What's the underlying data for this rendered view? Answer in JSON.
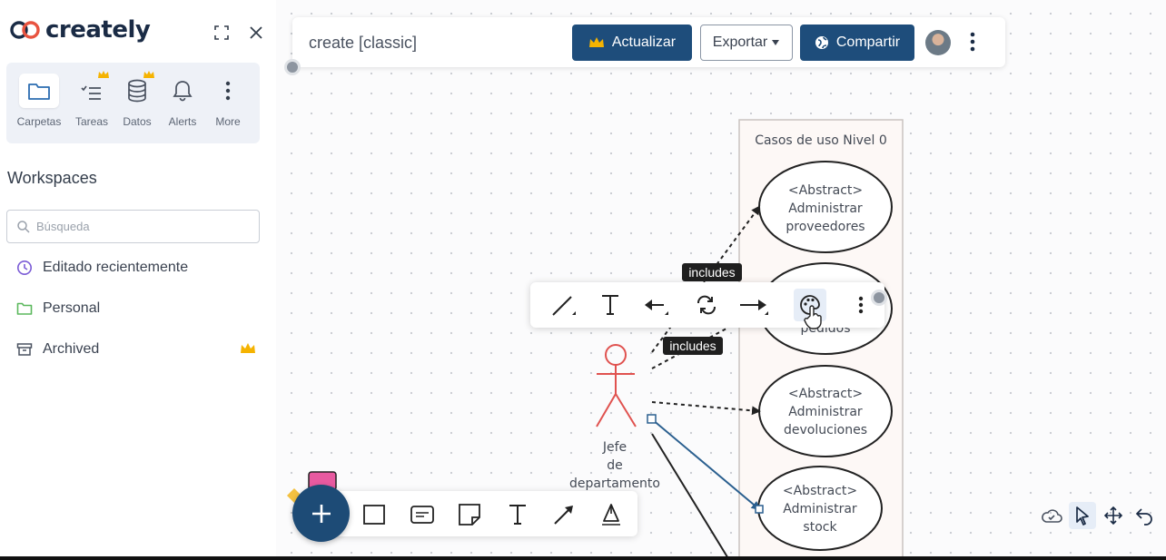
{
  "sidebar": {
    "brand": "creately",
    "quick_items": [
      {
        "label": "Carpetas",
        "icon": "folder-icon"
      },
      {
        "label": "Tareas",
        "icon": "tasks-icon"
      },
      {
        "label": "Datos",
        "icon": "database-icon"
      },
      {
        "label": "Alerts",
        "icon": "bell-icon"
      },
      {
        "label": "More",
        "icon": "more-vertical-icon"
      }
    ],
    "workspaces_title": "Workspaces",
    "search_placeholder": "Búsqueda",
    "nav": [
      {
        "label": "Editado recientemente",
        "icon": "clock-icon"
      },
      {
        "label": "Personal",
        "icon": "folder-icon"
      },
      {
        "label": "Archived",
        "icon": "archive-icon",
        "premium": true
      }
    ]
  },
  "topbar": {
    "doc_title": "create [classic]",
    "upgrade_label": "Actualizar",
    "export_label": "Exportar",
    "share_label": "Compartir"
  },
  "diagram": {
    "boundary_title": "Casos de uso Nivel 0",
    "use_cases": [
      {
        "lines": [
          "<Abstract>",
          "Administrar",
          "proveedores"
        ]
      },
      {
        "lines": [
          "pedidos"
        ]
      },
      {
        "lines": [
          "<Abstract>",
          "Administrar",
          "devoluciones"
        ]
      },
      {
        "lines": [
          "<Abstract>",
          "Administrar",
          "stock"
        ]
      }
    ],
    "actor_lines": [
      "Jefe",
      "de",
      "departamento"
    ],
    "relation_labels": [
      "includes",
      "includes"
    ]
  },
  "colors": {
    "primary": "#1e4d7b",
    "actor": "#e0524f",
    "crown": "#f5b301",
    "selected_connector": "#2a5f8f"
  }
}
